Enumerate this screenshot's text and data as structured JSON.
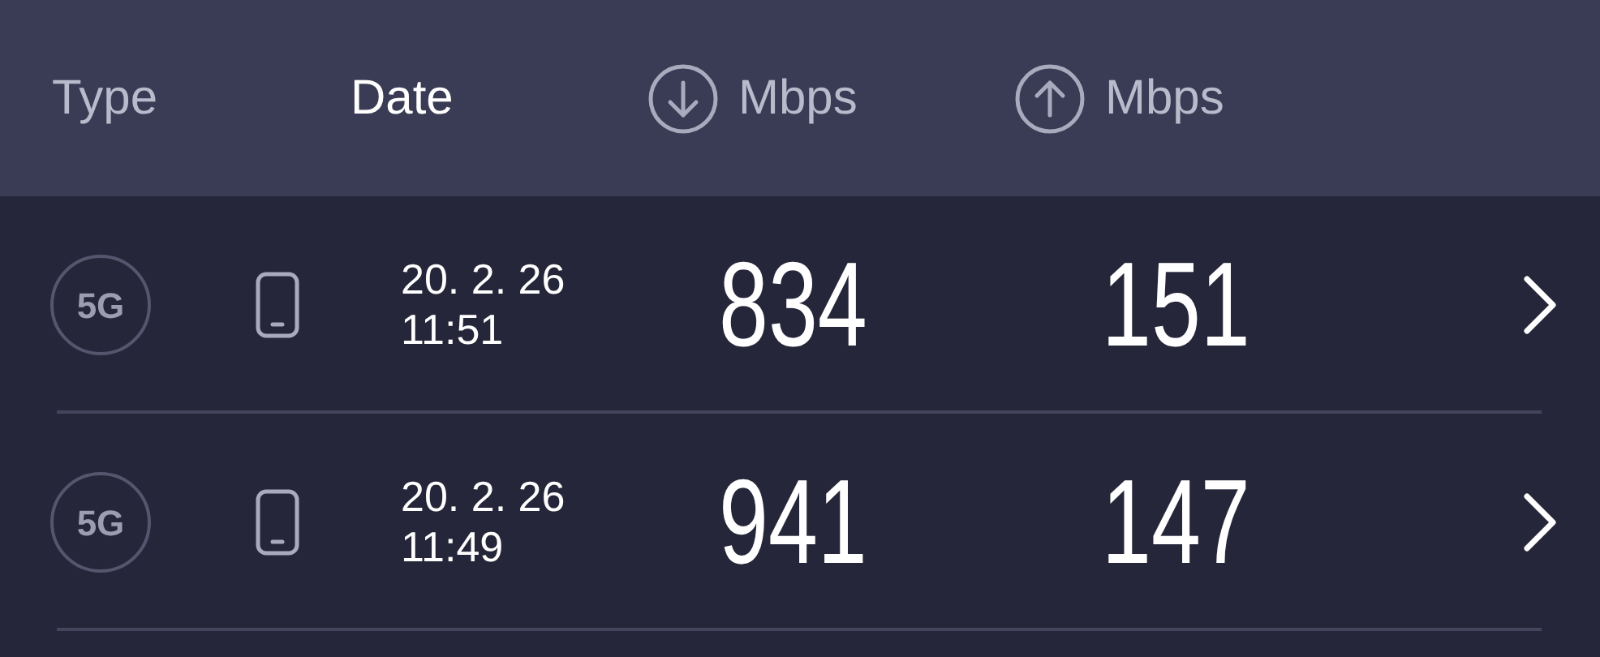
{
  "columns": [
    {
      "label": "Type",
      "kind": "text",
      "selected": false
    },
    {
      "label": "Date",
      "kind": "text",
      "selected": true
    },
    {
      "label": "Mbps",
      "kind": "download",
      "selected": false
    },
    {
      "label": "Mbps",
      "kind": "upload",
      "selected": false
    }
  ],
  "rows": [
    {
      "network": "5G",
      "date": "20. 2. 26",
      "time": "11:51",
      "download": "834",
      "upload": "151"
    },
    {
      "network": "5G",
      "date": "20. 2. 26",
      "time": "11:49",
      "download": "941",
      "upload": "147"
    }
  ]
}
